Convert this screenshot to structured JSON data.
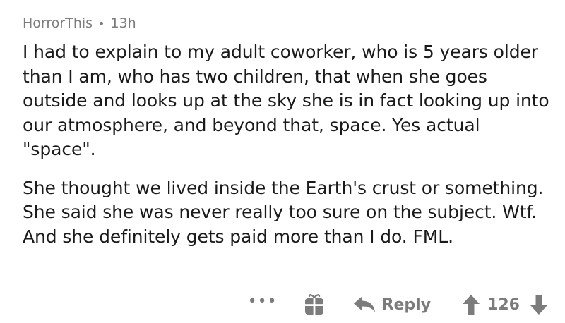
{
  "comment": {
    "author": "HorrorThis",
    "separator": "•",
    "age": "13h",
    "paragraphs": [
      "I had to explain to my adult coworker, who is 5 years older than I am, who has two children, that when she goes outside and looks up at the sky she is in fact looking up into our atmosphere, and beyond that, space. Yes actual \"space\".",
      "She thought we lived inside the Earth's crust or something. She said she was never really too sure on the subject. Wtf. And she definitely gets paid more than I do. FML."
    ]
  },
  "actions": {
    "more_label": "•••",
    "reply_label": "Reply",
    "score": "126"
  },
  "colors": {
    "text": "#1a1a1b",
    "muted": "#7c7c7c"
  }
}
